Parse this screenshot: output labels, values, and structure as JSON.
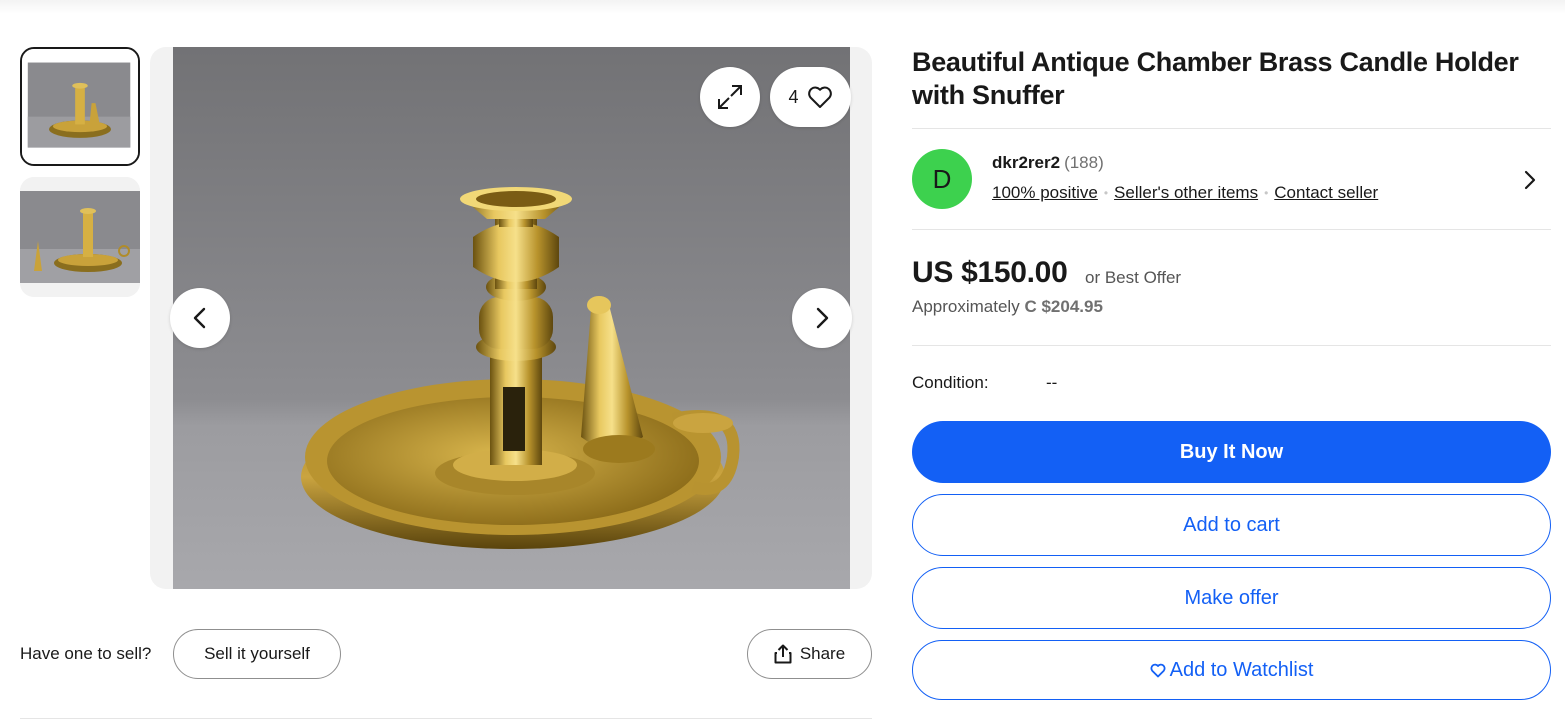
{
  "listing": {
    "title": "Beautiful Antique Chamber Brass Candle Holder with Snuffer",
    "watch_count": "4"
  },
  "gallery": {
    "thumbnails": [
      "thumbnail-1",
      "thumbnail-2"
    ],
    "selected_index": 0
  },
  "seller": {
    "initial": "D",
    "name": "dkr2rer2",
    "feedback_count": "(188)",
    "positive": "100% positive",
    "other_items": "Seller's other items",
    "contact": "Contact seller"
  },
  "price": {
    "main": "US $150.00",
    "best_offer": "or Best Offer",
    "approx_label": "Approximately",
    "approx_value": "C $204.95"
  },
  "condition": {
    "label": "Condition:",
    "value": "--"
  },
  "actions": {
    "buy_now": "Buy It Now",
    "add_to_cart": "Add to cart",
    "make_offer": "Make offer",
    "watchlist": "Add to Watchlist"
  },
  "sell": {
    "prompt": "Have one to sell?",
    "button": "Sell it yourself",
    "share": "Share"
  },
  "colors": {
    "primary_blue": "#1360f5",
    "avatar_green": "#3dd14e",
    "text": "#191919"
  }
}
